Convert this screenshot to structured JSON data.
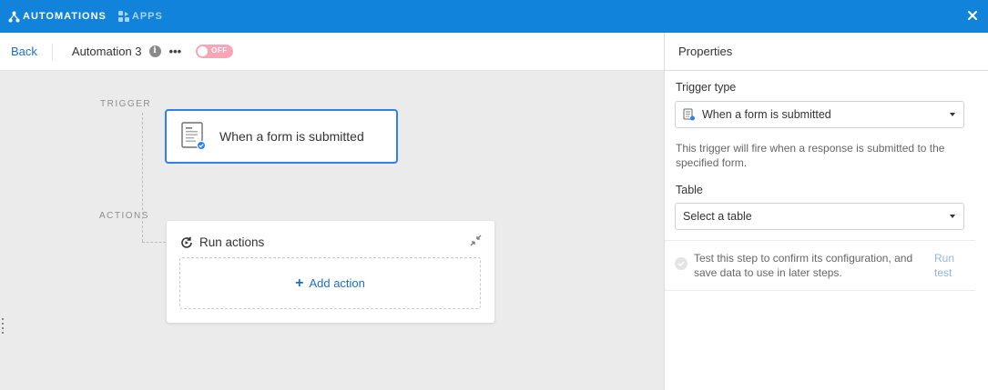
{
  "topbar": {
    "automations_label": "AUTOMATIONS",
    "apps_label": "APPS",
    "close_icon": "close-icon",
    "bg_color": "#1283da"
  },
  "header": {
    "back_label": "Back",
    "automation_name": "Automation 3",
    "info_icon_glyph": "i",
    "more_label": "•••",
    "toggle_label": "OFF",
    "toggle_color": "#f7a6b7"
  },
  "canvas": {
    "trigger_label": "TRIGGER",
    "actions_label": "ACTIONS",
    "trigger_card": {
      "title": "When a form is submitted",
      "icon": "form-icon"
    },
    "actions_card": {
      "title": "Run actions",
      "add_action_label": "Add action",
      "icon": "run-actions-icon"
    }
  },
  "panel": {
    "title": "Properties",
    "trigger_type_label": "Trigger type",
    "trigger_type_value": "When a form is submitted",
    "trigger_description": "This trigger will fire when a response is submitted to the specified form.",
    "table_label": "Table",
    "table_value": "Select a table",
    "test_text": "Test this step to confirm its configuration, and save data to use in later steps.",
    "run_test_label": "Run test"
  },
  "colors": {
    "accent": "#2d7ff9",
    "link": "#1f6fc1"
  }
}
